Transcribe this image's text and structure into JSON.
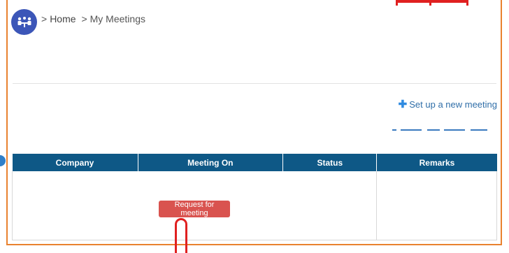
{
  "breadcrumb": {
    "separator": ">",
    "items": [
      "Home",
      "My Meetings"
    ]
  },
  "actions": {
    "setup_icon": "plus-icon",
    "setup_label": "Set up a new meeting"
  },
  "table": {
    "columns": [
      "Company",
      "Meeting On",
      "Status",
      "Remarks"
    ],
    "request_button_label": "Request for meeting"
  },
  "colors": {
    "frame": "#e9822f",
    "header_bg": "#0e5886",
    "logo_bg": "#3c56b8",
    "link": "#2f6ea8",
    "button": "#d9534f",
    "highlight": "#e02020"
  },
  "icons": {
    "logo": "meeting-people-icon",
    "pointer": "pointer-marker"
  }
}
